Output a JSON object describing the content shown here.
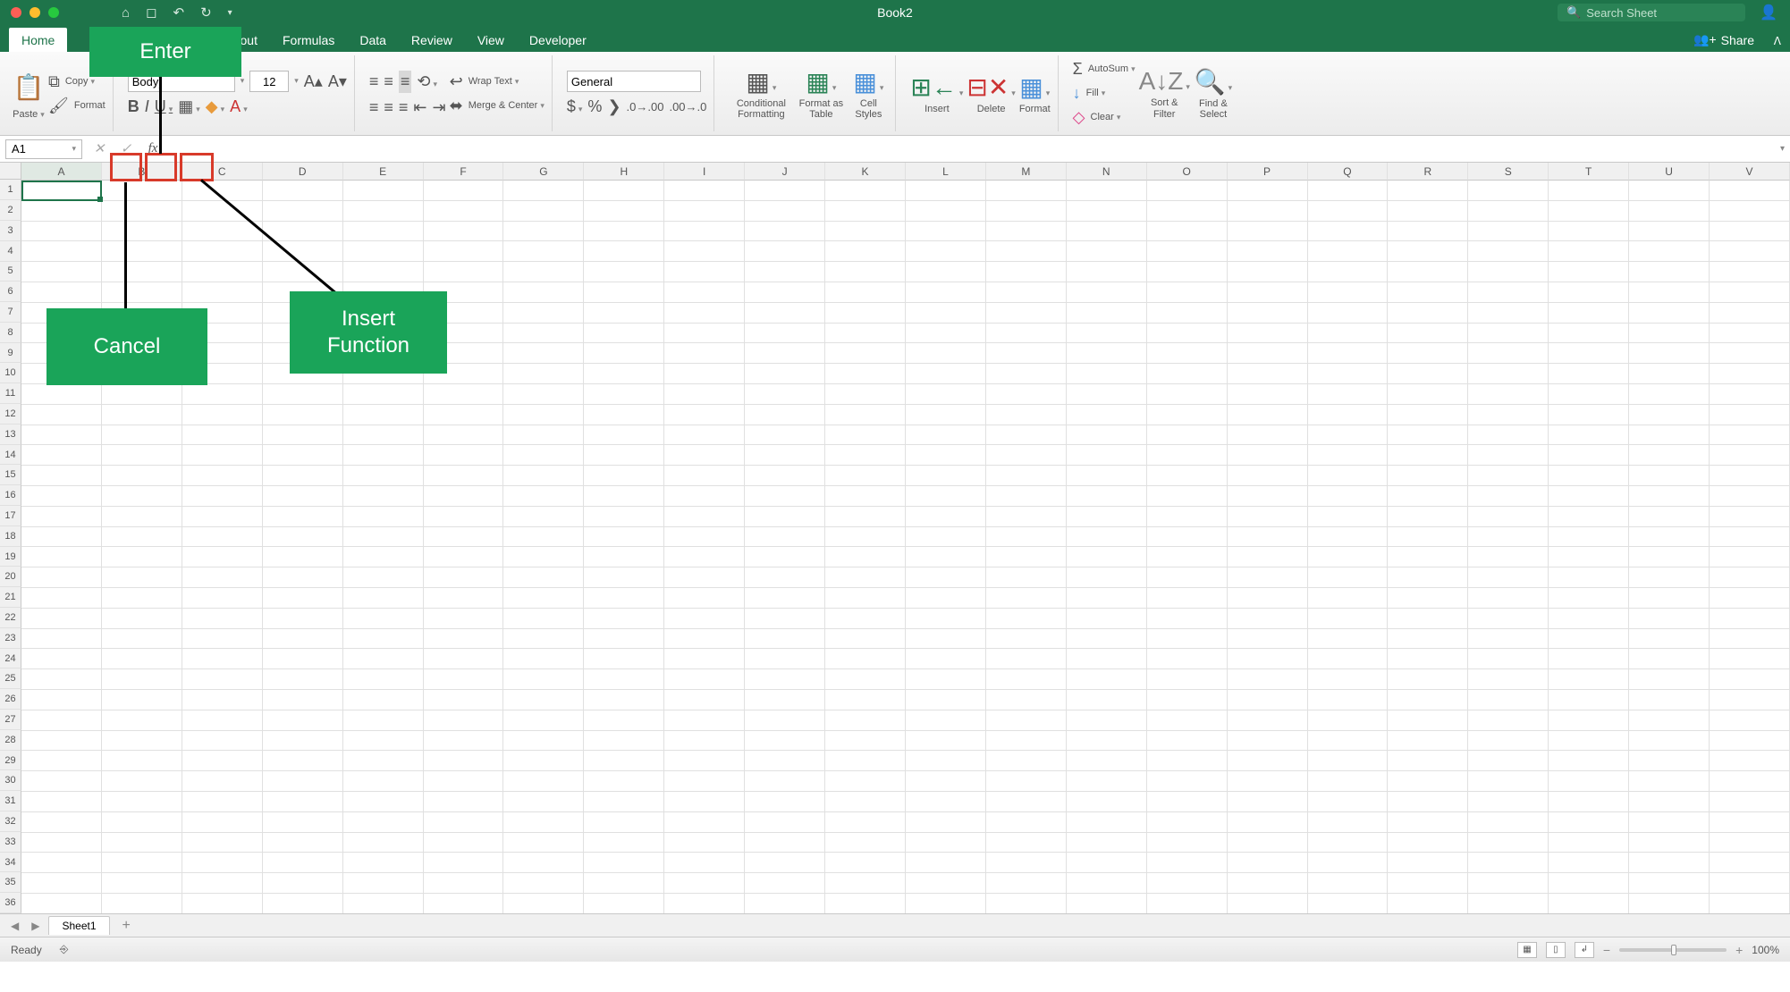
{
  "title": "Book2",
  "search_placeholder": "Search Sheet",
  "share_label": "Share",
  "tabs": [
    "Home",
    "",
    "Page Layout",
    "Formulas",
    "Data",
    "Review",
    "View",
    "Developer"
  ],
  "ribbon": {
    "paste": "Paste",
    "copy": "Copy",
    "format_painter": "Format",
    "font_name": "Body)",
    "font_size": "12",
    "wrap": "Wrap Text",
    "merge": "Merge & Center",
    "num_format": "General",
    "autosum": "AutoSum",
    "fill": "Fill",
    "clear": "Clear",
    "cond_format": "Conditional Formatting",
    "format_table": "Format as Table",
    "cell_styles": "Cell Styles",
    "insert": "Insert",
    "delete": "Delete",
    "format": "Format",
    "sort": "Sort & Filter",
    "find": "Find & Select"
  },
  "formula_bar": {
    "name_box": "A1"
  },
  "columns": [
    "A",
    "B",
    "C",
    "D",
    "E",
    "F",
    "G",
    "H",
    "I",
    "J",
    "K",
    "L",
    "M",
    "N",
    "O",
    "P",
    "Q",
    "R",
    "S",
    "T",
    "U",
    "V"
  ],
  "rows": [
    "1",
    "2",
    "3",
    "4",
    "5",
    "6",
    "7",
    "8",
    "9",
    "10",
    "11",
    "12",
    "13",
    "14",
    "15",
    "16",
    "17",
    "18",
    "19",
    "20",
    "21",
    "22",
    "23",
    "24",
    "25",
    "26",
    "27",
    "28",
    "29",
    "30",
    "31",
    "32",
    "33",
    "34",
    "35",
    "36"
  ],
  "sheet_tab": "Sheet1",
  "status_text": "Ready",
  "zoom": "100%",
  "annotations": {
    "enter": "Enter",
    "cancel": "Cancel",
    "insert_fn": "Insert\nFunction"
  }
}
